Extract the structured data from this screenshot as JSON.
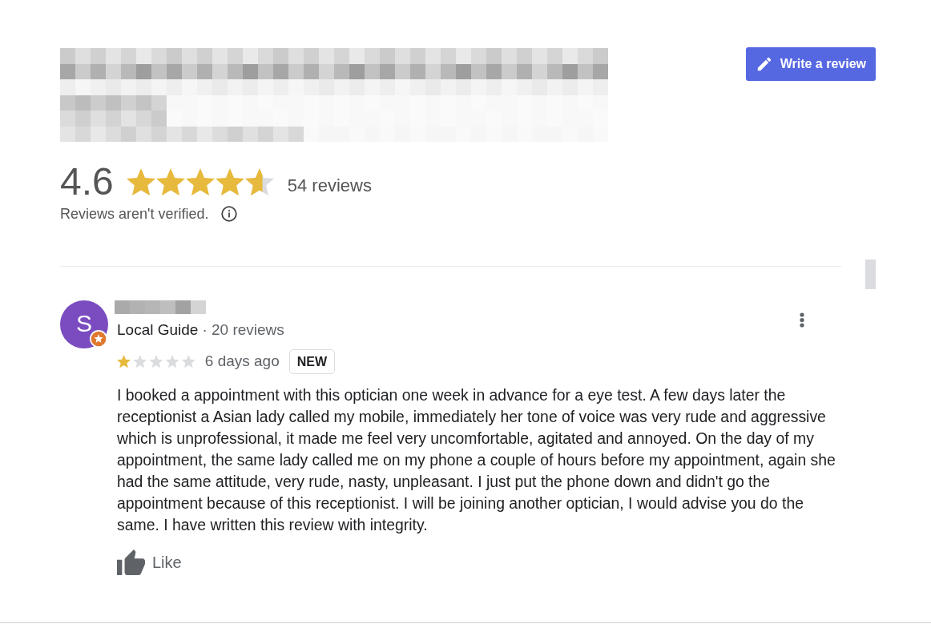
{
  "header": {
    "write_review_button": "Write a review"
  },
  "summary": {
    "rating": "4.6",
    "stars": 4.6,
    "review_count": "54 reviews",
    "note": "Reviews aren't verified."
  },
  "reviews": [
    {
      "avatar_letter": "S",
      "local_guide": true,
      "reviewer_type": "Local Guide",
      "reviewer_reviews": "· 20 reviews",
      "stars": 1,
      "time": "6 days ago",
      "badge": "NEW",
      "text": "I booked a appointment with this optician one week in advance for a eye test. A few days later the receptionist a Asian lady called my mobile, immediately her tone of voice was very rude and aggressive which is unprofessional, it made me feel very uncomfortable, agitated and annoyed. On the day of my appointment, the same lady called me on my phone a couple of hours before my appointment, again she had the same attitude, very rude, nasty, unpleasant. I just put the phone down and didn't go the appointment because of this receptionist. I will be joining another optician, I would advise you do the same. I have written this review with integrity.",
      "like": "Like"
    }
  ]
}
